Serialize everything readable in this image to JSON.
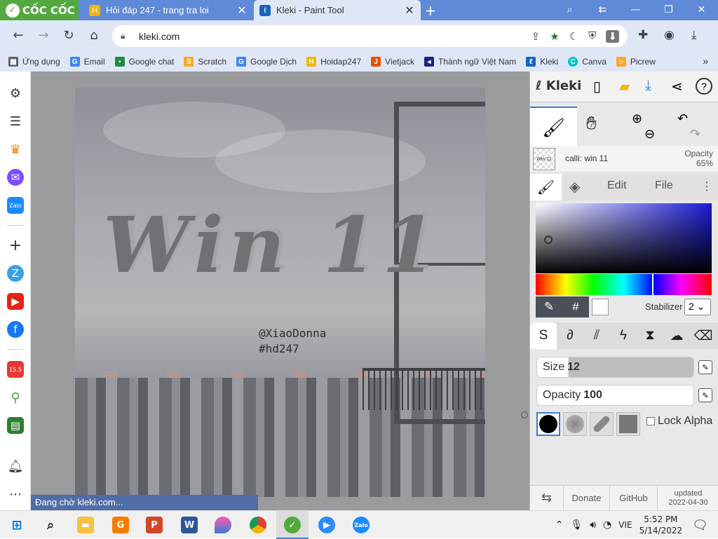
{
  "browser": {
    "brand": "CỐC CỐC",
    "tabs": [
      {
        "title": "Hỏi đáp 247 - trang tra loi",
        "active": false
      },
      {
        "title": "Kleki - Paint Tool",
        "active": true
      }
    ],
    "url": "kleki.com",
    "status_text": "Đang chờ kleki.com..."
  },
  "bookmarks": [
    {
      "label": "Ứng dụng",
      "icon": "apps-grid-icon",
      "color": "#5f6368"
    },
    {
      "label": "Email",
      "icon": "google-icon",
      "color": "#4285f4"
    },
    {
      "label": "Google chat",
      "icon": "chat-icon",
      "color": "#1e8e3e"
    },
    {
      "label": "Scratch",
      "icon": "scratch-icon",
      "color": "#f9a825"
    },
    {
      "label": "Google Dịch",
      "icon": "translate-icon",
      "color": "#4285f4"
    },
    {
      "label": "Hoidap247",
      "icon": "hoidap-icon",
      "color": "#f4b400"
    },
    {
      "label": "Vietjack",
      "icon": "vietjack-icon",
      "color": "#e65100"
    },
    {
      "label": "Thành ngữ Việt Nam",
      "icon": "audio-icon",
      "color": "#1a237e"
    },
    {
      "label": "Kleki",
      "icon": "kleki-icon",
      "color": "#1565c0"
    },
    {
      "label": "Canva",
      "icon": "canva-icon",
      "color": "#00c4cc"
    },
    {
      "label": "Picrew",
      "icon": "picrew-icon",
      "color": "#f9a825"
    }
  ],
  "artwork": {
    "title_text": "Win 11",
    "handle": "@XiaoDonna",
    "hashtag": "#hd247"
  },
  "kleki": {
    "logo": "Kleki",
    "layer_thumb": "Win 11",
    "layer_name": "calli: win 11",
    "layer_opacity_label": "Opacity",
    "layer_opacity_value": "65%",
    "tab_edit": "Edit",
    "tab_file": "File",
    "stabilizer_label": "Stabilizer",
    "stabilizer_value": "2",
    "size_label": "Size",
    "size_value": "12",
    "opacity_label": "Opacity",
    "opacity_value": "100",
    "lock_alpha": "Lock Alpha",
    "footer_donate": "Donate",
    "footer_github": "GitHub",
    "footer_updated": "updated",
    "footer_date": "2022-04-30",
    "hue_color": "#1b1bd8"
  },
  "taskbar": {
    "lang": "VIE",
    "time": "5:52 PM",
    "date": "5/14/2022"
  }
}
